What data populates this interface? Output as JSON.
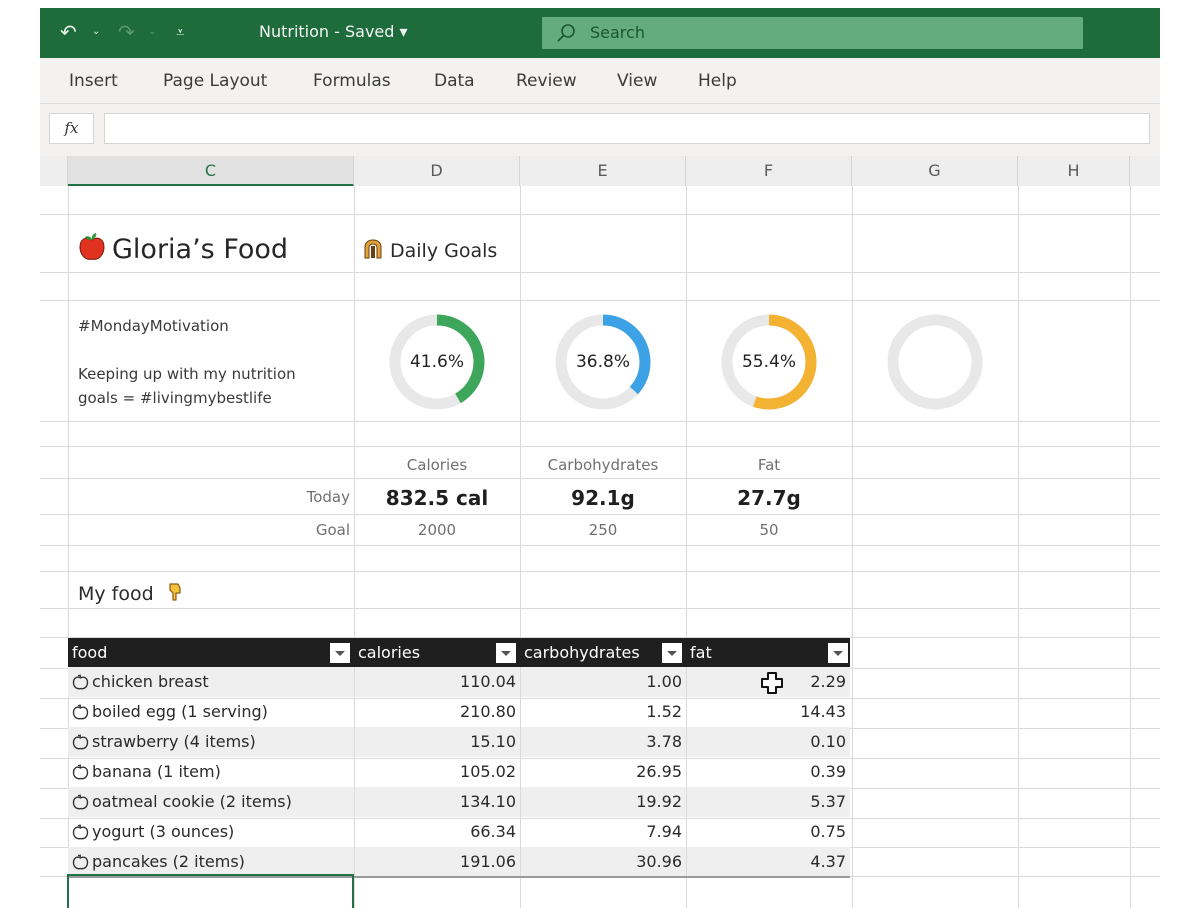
{
  "titlebar": {
    "undo_icon": "undo-icon",
    "redo_icon": "redo-icon",
    "customize_icon": "customize-quick-access-icon",
    "doc_title": "Nutrition  -  Saved ▾",
    "search_placeholder": "Search"
  },
  "ribbon": {
    "tabs": [
      "Insert",
      "Page Layout",
      "Formulas",
      "Data",
      "Review",
      "View",
      "Help"
    ]
  },
  "formula_bar": {
    "fx_label": "fx",
    "value": ""
  },
  "grid": {
    "columns": [
      "C",
      "D",
      "E",
      "F",
      "G",
      "H"
    ],
    "selected_column": "C"
  },
  "sheet": {
    "title": "Gloria’s Food",
    "daily_goals": "Daily Goals",
    "motivation_line1": "#MondayMotivation",
    "motivation_line2": "Keeping up with my nutrition",
    "motivation_line3": "goals = #livingmybestlife",
    "progress": [
      {
        "name": "Calories",
        "percent": 41.6,
        "label": "41.6%",
        "color": "#3ea65a"
      },
      {
        "name": "Carbohydrates",
        "percent": 36.8,
        "label": "36.8%",
        "color": "#3da1e6"
      },
      {
        "name": "Fat",
        "percent": 55.4,
        "label": "55.4%",
        "color": "#f4b233"
      },
      {
        "name": "Empty",
        "percent": 0,
        "label": "",
        "color": "#e8e8e8"
      }
    ],
    "summary": {
      "headers": [
        "Calories",
        "Carbohydrates",
        "Fat"
      ],
      "today_label": "Today",
      "today": [
        "832.5 cal",
        "92.1g",
        "27.7g"
      ],
      "goal_label": "Goal",
      "goal": [
        "2000",
        "250",
        "50"
      ]
    },
    "my_food": "My food",
    "table": {
      "headers": [
        "food",
        "calories",
        "carbohydrates",
        "fat"
      ],
      "rows": [
        [
          "chicken breast",
          "110.04",
          "1.00",
          "2.29"
        ],
        [
          "boiled egg (1 serving)",
          "210.80",
          "1.52",
          "14.43"
        ],
        [
          "strawberry (4 items)",
          "15.10",
          "3.78",
          "0.10"
        ],
        [
          "banana (1 item)",
          "105.02",
          "26.95",
          "0.39"
        ],
        [
          "oatmeal cookie (2 items)",
          "134.10",
          "19.92",
          "5.37"
        ],
        [
          "yogurt (3 ounces)",
          "66.34",
          "7.94",
          "0.75"
        ],
        [
          "pancakes (2 items)",
          "191.06",
          "30.96",
          "4.37"
        ]
      ]
    }
  }
}
